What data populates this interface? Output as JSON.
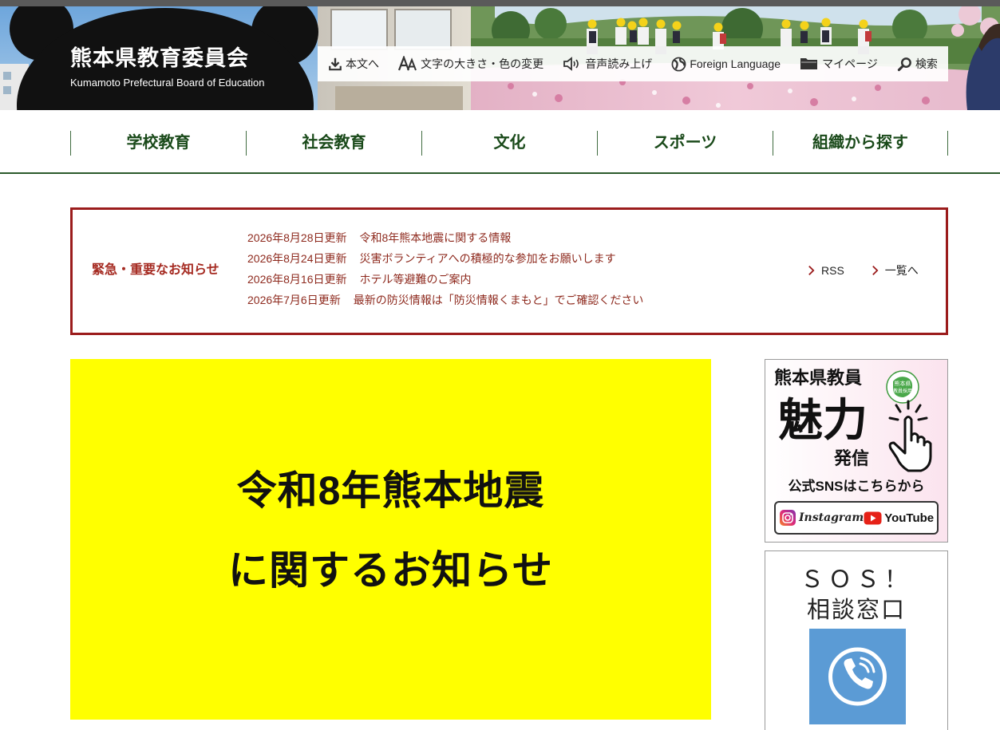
{
  "header": {
    "site_title": "熊本県教育委員会",
    "site_subtitle": "Kumamoto Prefectural Board of Education",
    "utility_links": [
      {
        "label": "本文へ",
        "icon": "download-icon"
      },
      {
        "label": "文字の大きさ・色の変更",
        "icon": "text-size-icon"
      },
      {
        "label": "音声読み上げ",
        "icon": "speaker-icon"
      },
      {
        "label": "Foreign Language",
        "icon": "globe-icon"
      },
      {
        "label": "マイページ",
        "icon": "folder-icon"
      },
      {
        "label": "検索",
        "icon": "search-icon"
      }
    ]
  },
  "nav": [
    {
      "label": "学校教育"
    },
    {
      "label": "社会教育"
    },
    {
      "label": "文化"
    },
    {
      "label": "スポーツ"
    },
    {
      "label": "組織から探す"
    }
  ],
  "notice": {
    "heading": "緊急・重要なお知らせ",
    "items": [
      {
        "date": "2026年8月28日更新",
        "title": "令和8年熊本地震に関する情報"
      },
      {
        "date": "2026年8月24日更新",
        "title": "災害ボランティアへの積極的な参加をお願いします"
      },
      {
        "date": "2026年8月16日更新",
        "title": "ホテル等避難のご案内"
      },
      {
        "date": "2026年7月6日更新",
        "title": "最新の防災情報は「防災情報くまもと」でご確認ください"
      }
    ],
    "rss_label": "RSS",
    "list_label": "一覧へ"
  },
  "main_banner": {
    "line1": "令和8年熊本地震",
    "line2": "に関するお知らせ"
  },
  "sidebar": {
    "sns_banner": {
      "line1": "熊本県教員",
      "line2": "魅力",
      "line3": "発信",
      "caption": "公式SNSはこちらから",
      "instagram": "Instagram",
      "youtube": "YouTube",
      "badge_top": "熊本県",
      "badge_bottom": "教員採用"
    },
    "sos_banner": {
      "line1": "ＳＯＳ！",
      "line2": "相談窓口",
      "icon": "phone-icon"
    }
  },
  "colors": {
    "nav_text": "#1a4a1a",
    "alert_red": "#9b1c1c",
    "banner_yellow": "#ffff00",
    "sos_blue": "#5b9bd5"
  }
}
